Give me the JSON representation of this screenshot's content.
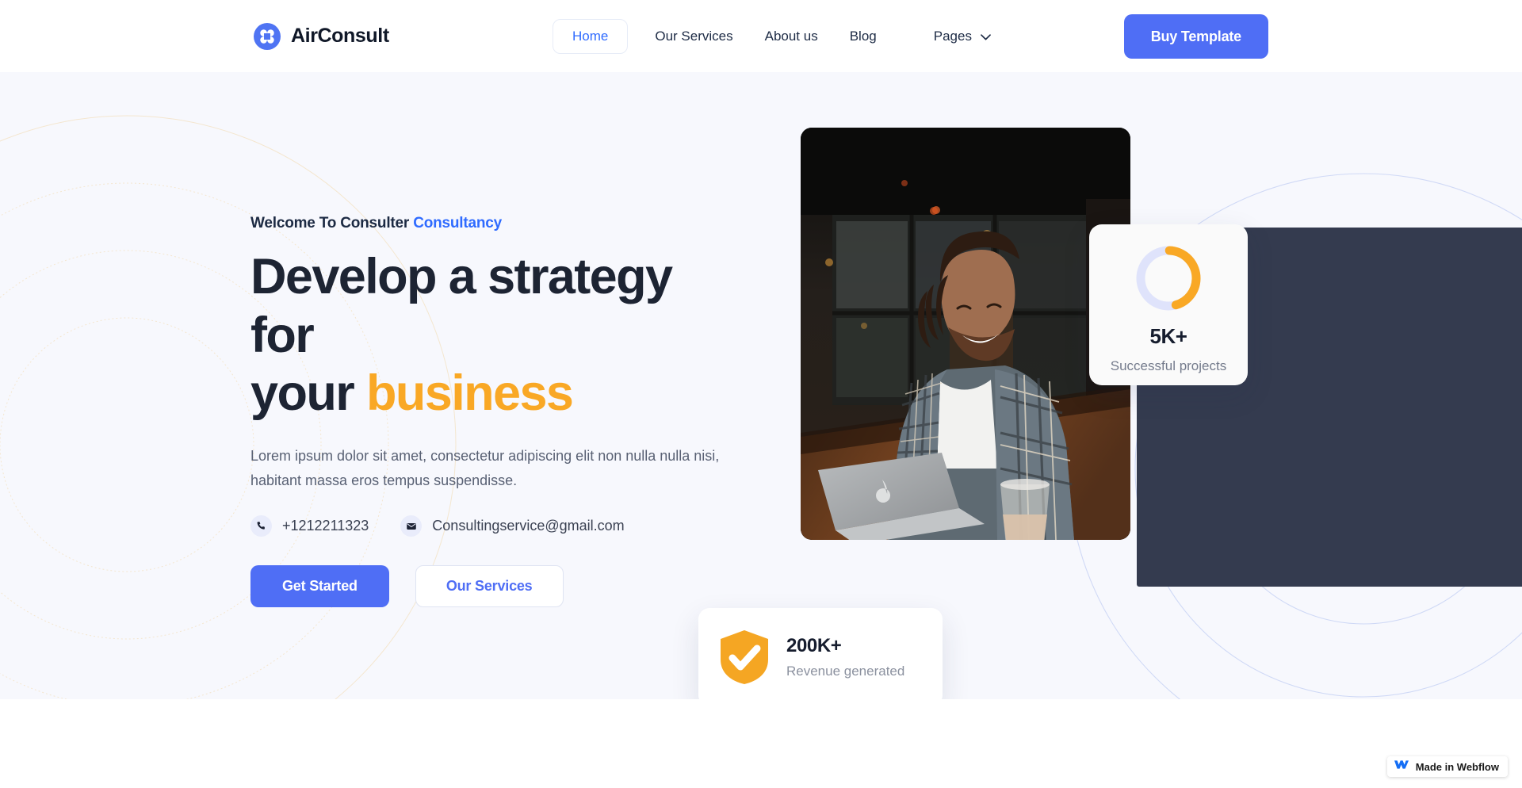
{
  "brand": {
    "name": "AirConsult",
    "logo_icon": "clover-logo-icon",
    "logo_color": "#4f74f3"
  },
  "nav": {
    "items": [
      {
        "label": "Home",
        "active": true
      },
      {
        "label": "Our Services",
        "active": false
      },
      {
        "label": "About us",
        "active": false
      },
      {
        "label": "Blog",
        "active": false
      },
      {
        "label": "Pages",
        "active": false,
        "has_dropdown": true
      }
    ],
    "cta": {
      "label": "Buy Template",
      "color": "#4f6ef5"
    }
  },
  "hero": {
    "eyebrow_prefix": "Welcome To Consulter ",
    "eyebrow_accent": "Consultancy",
    "headline_line1": "Develop a strategy for",
    "headline_line2_prefix": "your ",
    "headline_accent": "business",
    "paragraph": "Lorem ipsum dolor sit amet, consectetur adipiscing elit non nulla nulla nisi, habitant massa eros tempus suspendisse.",
    "contacts": [
      {
        "icon": "phone-icon",
        "text": "+1212211323"
      },
      {
        "icon": "mail-icon",
        "text": "Consultingservice@gmail.com"
      }
    ],
    "buttons": [
      {
        "label": "Get Started",
        "style": "primary"
      },
      {
        "label": "Our Services",
        "style": "ghost"
      }
    ],
    "accent_blue": "#2f6bff",
    "accent_orange": "#f9a825"
  },
  "stats": {
    "projects": {
      "value": "5K+",
      "label": "Successful projects",
      "donut_percent": 45,
      "donut_fill_color": "#f9a825",
      "donut_track_color": "#dfe3fb"
    },
    "revenue": {
      "value": "200K+",
      "label": "Revenue generated",
      "icon": "shield-check-icon",
      "icon_color": "#f5a623"
    }
  },
  "badge": {
    "label": "Made in Webflow",
    "icon": "webflow-icon"
  }
}
